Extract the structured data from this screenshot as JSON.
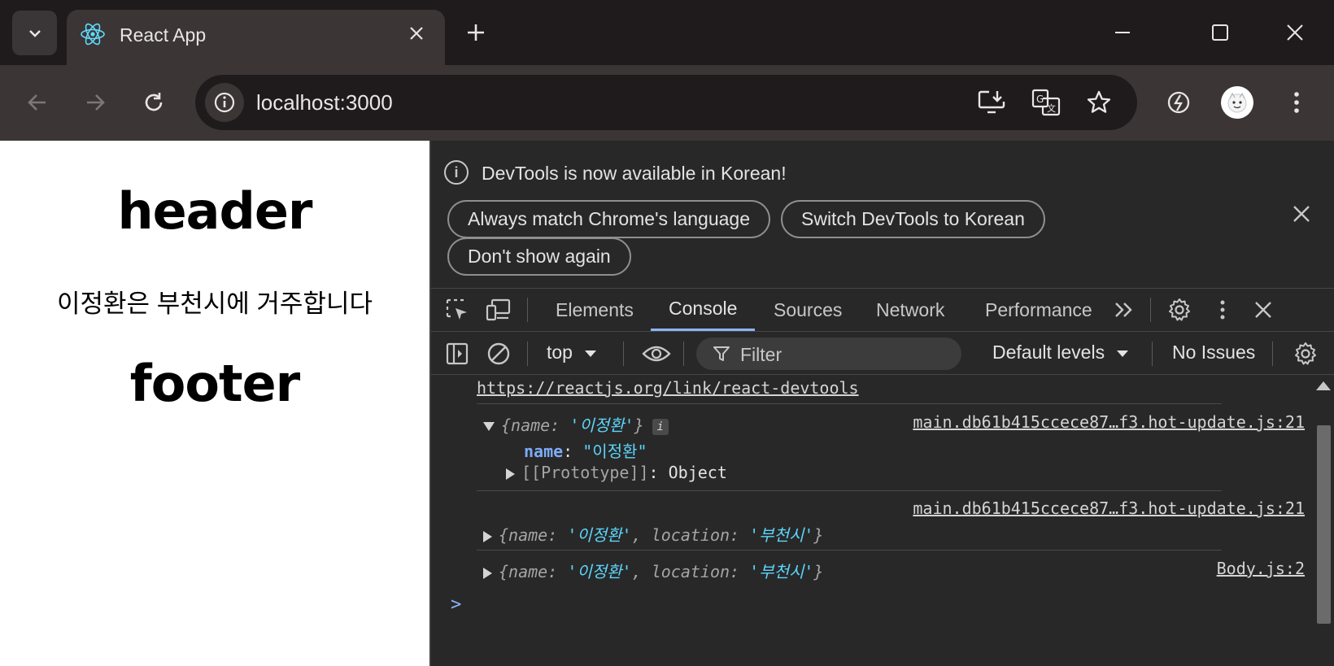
{
  "browser": {
    "tab_title": "React App",
    "url": "localhost:3000"
  },
  "page": {
    "header": "header",
    "body_text": "이정환은 부천시에 거주합니다",
    "footer": "footer"
  },
  "devtools": {
    "infobar": {
      "message": "DevTools is now available in Korean!",
      "btn_match": "Always match Chrome's language",
      "btn_switch": "Switch DevTools to Korean",
      "btn_dont_show": "Don't show again"
    },
    "tabs": [
      "Elements",
      "Console",
      "Sources",
      "Network",
      "Performance"
    ],
    "active_tab": "Console",
    "console_toolbar": {
      "context": "top",
      "filter_placeholder": "Filter",
      "levels": "Default levels",
      "issues": "No Issues"
    },
    "console": {
      "link": "https://reactjs.org/link/react-devtools",
      "msg1": {
        "summary_key": "name",
        "summary_value": "'이정환'",
        "source": "main.db61b415ccece87…f3.hot-update.js:21",
        "prop_key": "name",
        "prop_value": "\"이정환\"",
        "proto_label": "[[Prototype]]",
        "proto_value": "Object"
      },
      "msg2": {
        "source": "main.db61b415ccece87…f3.hot-update.js:21",
        "name_key": "name",
        "name_value": "'이정환'",
        "loc_key": "location",
        "loc_value": "'부천시'"
      },
      "msg3": {
        "source": "Body.js:2",
        "name_key": "name",
        "name_value": "'이정환'",
        "loc_key": "location",
        "loc_value": "'부천시'"
      },
      "prompt": ">"
    }
  },
  "colors": {
    "accent": "#8ab4f8",
    "string": "#5cd5fb",
    "panel_bg": "#282828"
  }
}
